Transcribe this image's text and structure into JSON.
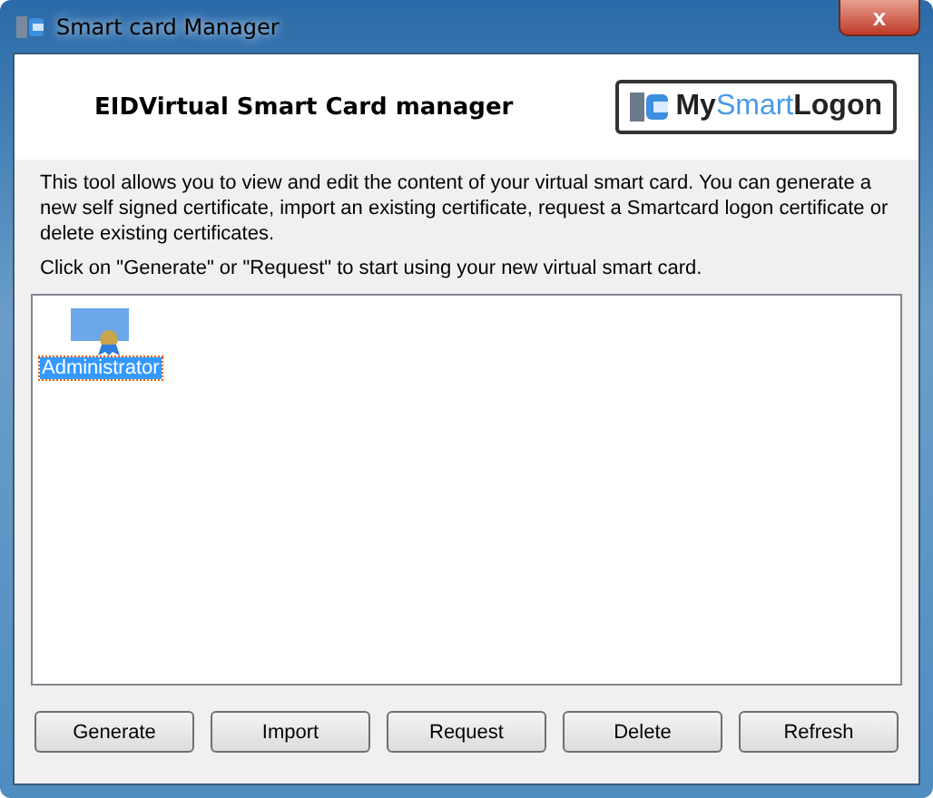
{
  "window": {
    "title": "Smart card Manager",
    "close_label": "x"
  },
  "header": {
    "title": "EIDVirtual Smart Card manager",
    "logo": [
      {
        "text": "My",
        "kind": "dark"
      },
      {
        "text": "Smart",
        "kind": "accent"
      },
      {
        "text": "Logon",
        "kind": "dark"
      }
    ]
  },
  "description": [
    "This tool allows you to view and edit the content of your virtual smart card. You can generate a new self signed certificate, import an existing certificate, request a Smartcard logon certificate or delete existing certificates.",
    "Click on \"Generate\" or \"Request\" to start using your new virtual smart card."
  ],
  "certificates": [
    {
      "label": "Administrator",
      "selected": true
    }
  ],
  "buttons": [
    "Generate",
    "Import",
    "Request",
    "Delete",
    "Refresh"
  ]
}
